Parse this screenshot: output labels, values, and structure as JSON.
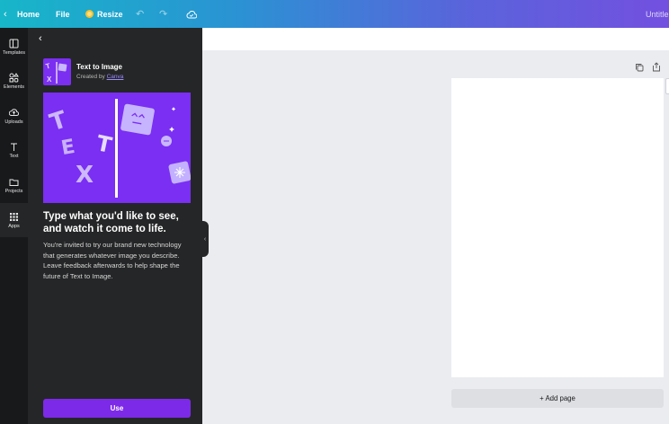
{
  "topbar": {
    "home_label": "Home",
    "file_label": "File",
    "resize_label": "Resize",
    "doc_title": "Untitle"
  },
  "rail": {
    "items": [
      {
        "label": "Templates",
        "icon": "templates-icon"
      },
      {
        "label": "Elements",
        "icon": "elements-icon"
      },
      {
        "label": "Uploads",
        "icon": "uploads-icon"
      },
      {
        "label": "Text",
        "icon": "text-icon"
      },
      {
        "label": "Projects",
        "icon": "projects-icon"
      },
      {
        "label": "Apps",
        "icon": "apps-icon",
        "active": true
      }
    ]
  },
  "panel": {
    "app_name": "Text to Image",
    "created_by_prefix": "Created by ",
    "created_by_link": "Canva",
    "headline": "Type what you'd like to see, and watch it come to life.",
    "description": "You're invited to try our brand new technology that generates whatever image you describe. Leave feedback afterwards to help shape the future of Text to Image.",
    "use_label": "Use",
    "hero_letters": [
      "T",
      "E",
      "X",
      "T"
    ]
  },
  "canvas": {
    "add_page_label": "+ Add page"
  },
  "colors": {
    "accent": "#7d2ae8",
    "hero_bg": "#7a2ff2",
    "rail_bg": "#18191b",
    "panel_bg": "#252627"
  }
}
